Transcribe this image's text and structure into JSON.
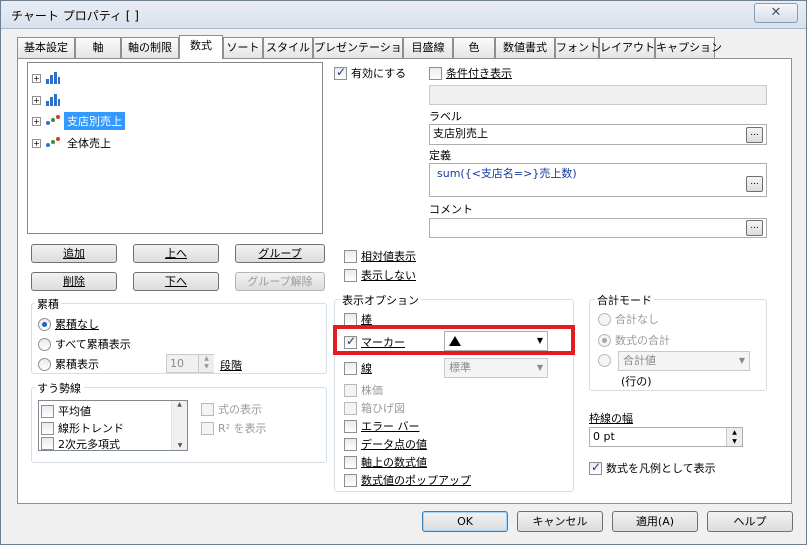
{
  "window": {
    "title": "チャート プロパティ [ ]",
    "close_glyph": "✕"
  },
  "tabs": [
    "基本設定",
    "軸",
    "軸の制限",
    "数式",
    "ソート",
    "スタイル",
    "プレゼンテーション",
    "目盛線",
    "色",
    "数値書式",
    "フォント",
    "レイアウト",
    "キャプション"
  ],
  "active_tab": "数式",
  "expression_tree": {
    "items": [
      {
        "label": "",
        "icon": "bar-chart-icon"
      },
      {
        "label": "",
        "icon": "bar-chart-icon"
      },
      {
        "label": "支店別売上",
        "icon": "scatter-icon",
        "selected": true
      },
      {
        "label": "全体売上",
        "icon": "scatter-icon"
      }
    ]
  },
  "buttons": {
    "add": "追加",
    "up": "上へ",
    "group": "グループ",
    "delete": "削除",
    "down": "下へ",
    "ungroup": "グループ解除"
  },
  "cumulative": {
    "title": "累積",
    "options": [
      "累積なし",
      "すべて累積表示",
      "累積表示"
    ],
    "selected": "累積なし",
    "steps_value": "10",
    "steps_label": "段階"
  },
  "trendline": {
    "title": "すう勢線",
    "items": [
      "平均値",
      "線形トレンド",
      "2次元多項式"
    ],
    "show_formula": "式の表示",
    "show_r2": "R² を表示"
  },
  "enabled": {
    "label": "有効にする",
    "checked": true
  },
  "conditional": {
    "label": "条件付き表示",
    "checked": false
  },
  "label_field": {
    "caption": "ラベル",
    "value": "支店別売上"
  },
  "definition": {
    "caption": "定義",
    "value": "sum({<支店名=>}売上数)"
  },
  "comment": {
    "caption": "コメント",
    "value": ""
  },
  "relative": "相対値表示",
  "invisible": "表示しない",
  "display_options": {
    "title": "表示オプション",
    "bar": {
      "label": "棒",
      "checked": false
    },
    "marker": {
      "label": "マーカー",
      "checked": true,
      "symbol": "▲"
    },
    "line": {
      "label": "線",
      "checked": false,
      "style": "標準"
    },
    "stock": "株価",
    "box": "箱ひげ図",
    "error": "エラー バー",
    "values_on_points": "データ点の値",
    "values_on_axis": "軸上の数式値",
    "popup": "数式値のポップアップ"
  },
  "total_mode": {
    "title": "合計モード",
    "options": [
      "合計なし",
      "数式の合計"
    ],
    "selected": "数式の合計",
    "sum_of_rows": "合計値",
    "sum_of_rows_suffix": "(行の)"
  },
  "border_width": {
    "label": "枠線の幅",
    "value": "0 pt"
  },
  "legend_expression": {
    "label": "数式を凡例として表示",
    "checked": true
  },
  "footer": {
    "ok": "OK",
    "cancel": "キャンセル",
    "apply": "適用(A)",
    "help": "ヘルプ"
  },
  "colors": {
    "highlight": "#e31b23",
    "selection": "#3399ff",
    "bars": "#2f6fd0"
  }
}
